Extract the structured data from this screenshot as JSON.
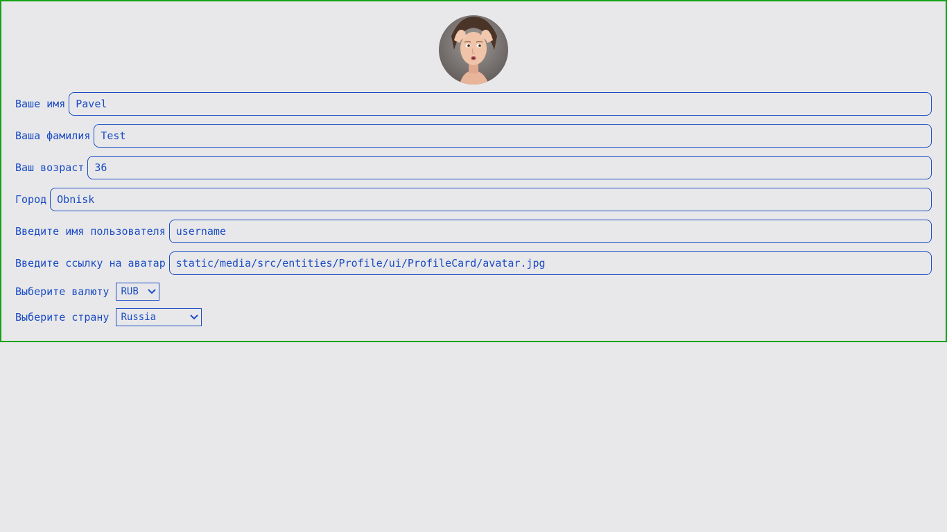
{
  "profile": {
    "avatar_alt": "avatar",
    "fields": [
      {
        "label": "Ваше имя",
        "value": "Pavel"
      },
      {
        "label": "Ваша фамилия",
        "value": "Test"
      },
      {
        "label": "Ваш возраст",
        "value": "36"
      },
      {
        "label": "Город",
        "value": "Obnisk"
      },
      {
        "label": "Введите имя пользователя",
        "value": "username"
      },
      {
        "label": "Введите ссылку на аватар",
        "value": "static/media/src/entities/Profile/ui/ProfileCard/avatar.jpg"
      }
    ],
    "currency": {
      "label": "Выберите валюту",
      "value": "RUB"
    },
    "country": {
      "label": "Выберите страну",
      "value": "Russia"
    }
  },
  "colors": {
    "accent": "#1a4bc4",
    "border": "#13a313",
    "background": "#e8e8ea"
  }
}
